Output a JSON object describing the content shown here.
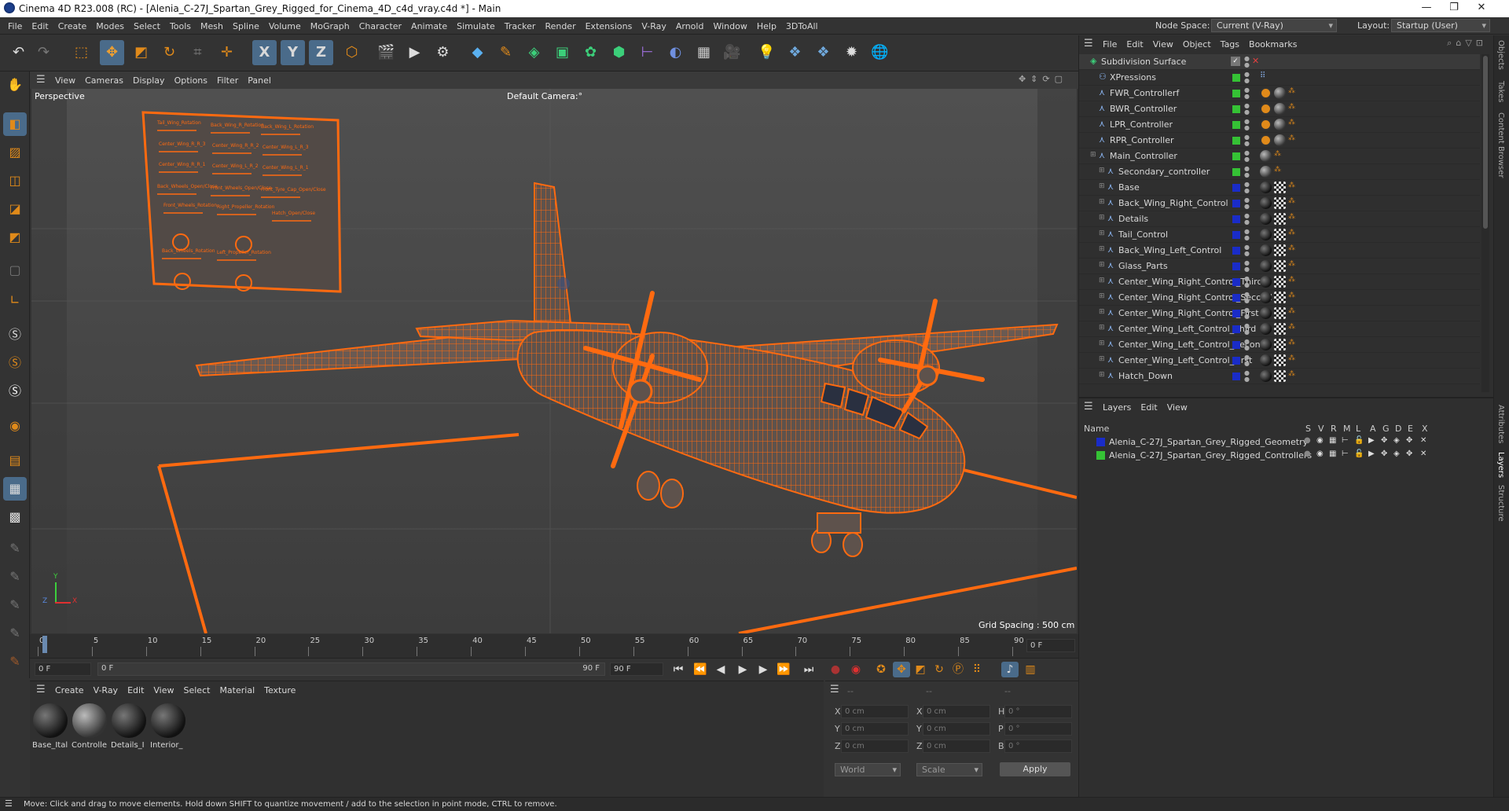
{
  "app": {
    "title": "Cinema 4D R23.008 (RC) - [Alenia_C-27J_Spartan_Grey_Rigged_for_Cinema_4D_c4d_vray.c4d *] - Main",
    "window_controls": [
      "—",
      "❐",
      "✕"
    ]
  },
  "menubar": {
    "items": [
      "File",
      "Edit",
      "Create",
      "Modes",
      "Select",
      "Tools",
      "Mesh",
      "Spline",
      "Volume",
      "MoGraph",
      "Character",
      "Animate",
      "Simulate",
      "Tracker",
      "Render",
      "Extensions",
      "V-Ray",
      "Arnold",
      "Window",
      "Help",
      "3DToAll"
    ],
    "node_space_label": "Node Space:",
    "node_space_value": "Current (V-Ray)",
    "layout_label": "Layout:",
    "layout_value": "Startup (User)"
  },
  "toolbar": {
    "axis_x": "X",
    "axis_y": "Y",
    "axis_z": "Z"
  },
  "viewport": {
    "menu": [
      "View",
      "Cameras",
      "Display",
      "Options",
      "Filter",
      "Panel"
    ],
    "label": "Perspective",
    "camera": "Default Camera",
    "camera_suffix": ":°",
    "grid_spacing": "Grid Spacing : 500 cm",
    "axis_x": "X",
    "axis_y": "Y",
    "axis_z": "Z",
    "wire_color": "#ff6a10",
    "ui_panel_labels": [
      "Tail_Wing_Rotation",
      "Back_Wing_R_Rotation",
      "Back_Wing_L_Rotation",
      "Center_Wing_R_R_3",
      "Center_Wing_R_R_2",
      "Center_Wing_L_R_3",
      "Center_Wing_R_R_1",
      "Center_Wing_L_R_2",
      "Center_Wing_L_R_1",
      "Back_Wheels_Open/Close",
      "Front_Wheels_Open/Close",
      "Front_Tyre_Cap_Open/Close",
      "Front_Wheels_Rotation",
      "Right_Propeller_Rotation",
      "Hatch_Open/Close",
      "Back_Wheels_Rotation",
      "Left_Propeller_Rotation"
    ]
  },
  "timeline": {
    "ticks": [
      "0",
      "5",
      "10",
      "15",
      "20",
      "25",
      "30",
      "35",
      "40",
      "45",
      "50",
      "55",
      "60",
      "65",
      "70",
      "75",
      "80",
      "85",
      "90"
    ],
    "current_frame_right": "0 F",
    "start_field": "0 F",
    "range_start": "0 F",
    "range_end": "90 F",
    "end_field": "90 F"
  },
  "material_panel": {
    "menu": [
      "Create",
      "V-Ray",
      "Edit",
      "View",
      "Select",
      "Material",
      "Texture"
    ],
    "materials": [
      {
        "name": "Base_Ital"
      },
      {
        "name": "Controlle"
      },
      {
        "name": "Details_I"
      },
      {
        "name": "Interior_"
      }
    ]
  },
  "coord_panel": {
    "headers": [
      "--",
      "--",
      "--"
    ],
    "rows": [
      {
        "a": "X",
        "av": "0 cm",
        "b": "X",
        "bv": "0 cm",
        "c": "H",
        "cv": "0 °"
      },
      {
        "a": "Y",
        "av": "0 cm",
        "b": "Y",
        "bv": "0 cm",
        "c": "P",
        "cv": "0 °"
      },
      {
        "a": "Z",
        "av": "0 cm",
        "b": "Z",
        "bv": "0 cm",
        "c": "B",
        "cv": "0 °"
      }
    ],
    "world": "World",
    "scale": "Scale",
    "apply": "Apply"
  },
  "status": {
    "text": "Move: Click and drag to move elements. Hold down SHIFT to quantize movement / add to the selection in point mode, CTRL to remove."
  },
  "object_manager": {
    "menu": [
      "File",
      "Edit",
      "View",
      "Object",
      "Tags",
      "Bookmarks"
    ],
    "objects": [
      {
        "name": "Subdivision Surface",
        "indent": 0,
        "layer": "",
        "tags": ""
      },
      {
        "name": "XPressions",
        "indent": 1,
        "layer": "#35c235",
        "tags": "xp"
      },
      {
        "name": "FWR_Controllerf",
        "indent": 1,
        "layer": "#35c235",
        "tags": "ctrl"
      },
      {
        "name": "BWR_Controller",
        "indent": 1,
        "layer": "#35c235",
        "tags": "ctrl"
      },
      {
        "name": "LPR_Controller",
        "indent": 1,
        "layer": "#35c235",
        "tags": "ctrl"
      },
      {
        "name": "RPR_Controller",
        "indent": 1,
        "layer": "#35c235",
        "tags": "ctrl"
      },
      {
        "name": "Main_Controller",
        "indent": 1,
        "layer": "#35c235",
        "tags": "main"
      },
      {
        "name": "Secondary_controller",
        "indent": 2,
        "layer": "#35c235",
        "tags": "main"
      },
      {
        "name": "Base",
        "indent": 2,
        "layer": "#1a2cc8",
        "tags": "geo"
      },
      {
        "name": "Back_Wing_Right_Control",
        "indent": 2,
        "layer": "#1a2cc8",
        "tags": "geo"
      },
      {
        "name": "Details",
        "indent": 2,
        "layer": "#1a2cc8",
        "tags": "geo"
      },
      {
        "name": "Tail_Control",
        "indent": 2,
        "layer": "#1a2cc8",
        "tags": "geo"
      },
      {
        "name": "Back_Wing_Left_Control",
        "indent": 2,
        "layer": "#1a2cc8",
        "tags": "geo"
      },
      {
        "name": "Glass_Parts",
        "indent": 2,
        "layer": "#1a2cc8",
        "tags": "geo"
      },
      {
        "name": "Center_Wing_Right_Control_Third",
        "indent": 2,
        "layer": "#1a2cc8",
        "tags": "geo"
      },
      {
        "name": "Center_Wing_Right_Control_Second",
        "indent": 2,
        "layer": "#1a2cc8",
        "tags": "geo"
      },
      {
        "name": "Center_Wing_Right_Control_First",
        "indent": 2,
        "layer": "#1a2cc8",
        "tags": "geo"
      },
      {
        "name": "Center_Wing_Left_Control_Third",
        "indent": 2,
        "layer": "#1a2cc8",
        "tags": "geo"
      },
      {
        "name": "Center_Wing_Left_Control_Second",
        "indent": 2,
        "layer": "#1a2cc8",
        "tags": "geo"
      },
      {
        "name": "Center_Wing_Left_Control_First",
        "indent": 2,
        "layer": "#1a2cc8",
        "tags": "geo"
      },
      {
        "name": "Hatch_Down",
        "indent": 2,
        "layer": "#1a2cc8",
        "tags": "geo"
      }
    ]
  },
  "layer_manager": {
    "menu": [
      "Layers",
      "Edit",
      "View"
    ],
    "columns": [
      "Name",
      "S",
      "V",
      "R",
      "M",
      "L",
      "A",
      "G",
      "D",
      "E",
      "X"
    ],
    "layers": [
      {
        "name": "Alenia_C-27J_Spartan_Grey_Rigged_Geometry",
        "color": "#1a2cc8"
      },
      {
        "name": "Alenia_C-27J_Spartan_Grey_Rigged_Controllers",
        "color": "#35c235"
      }
    ]
  },
  "right_tabs": {
    "top": [
      "Objects",
      "Takes",
      "Content Browser"
    ],
    "bottom": [
      "Attributes",
      "Layers",
      "Structure"
    ]
  }
}
